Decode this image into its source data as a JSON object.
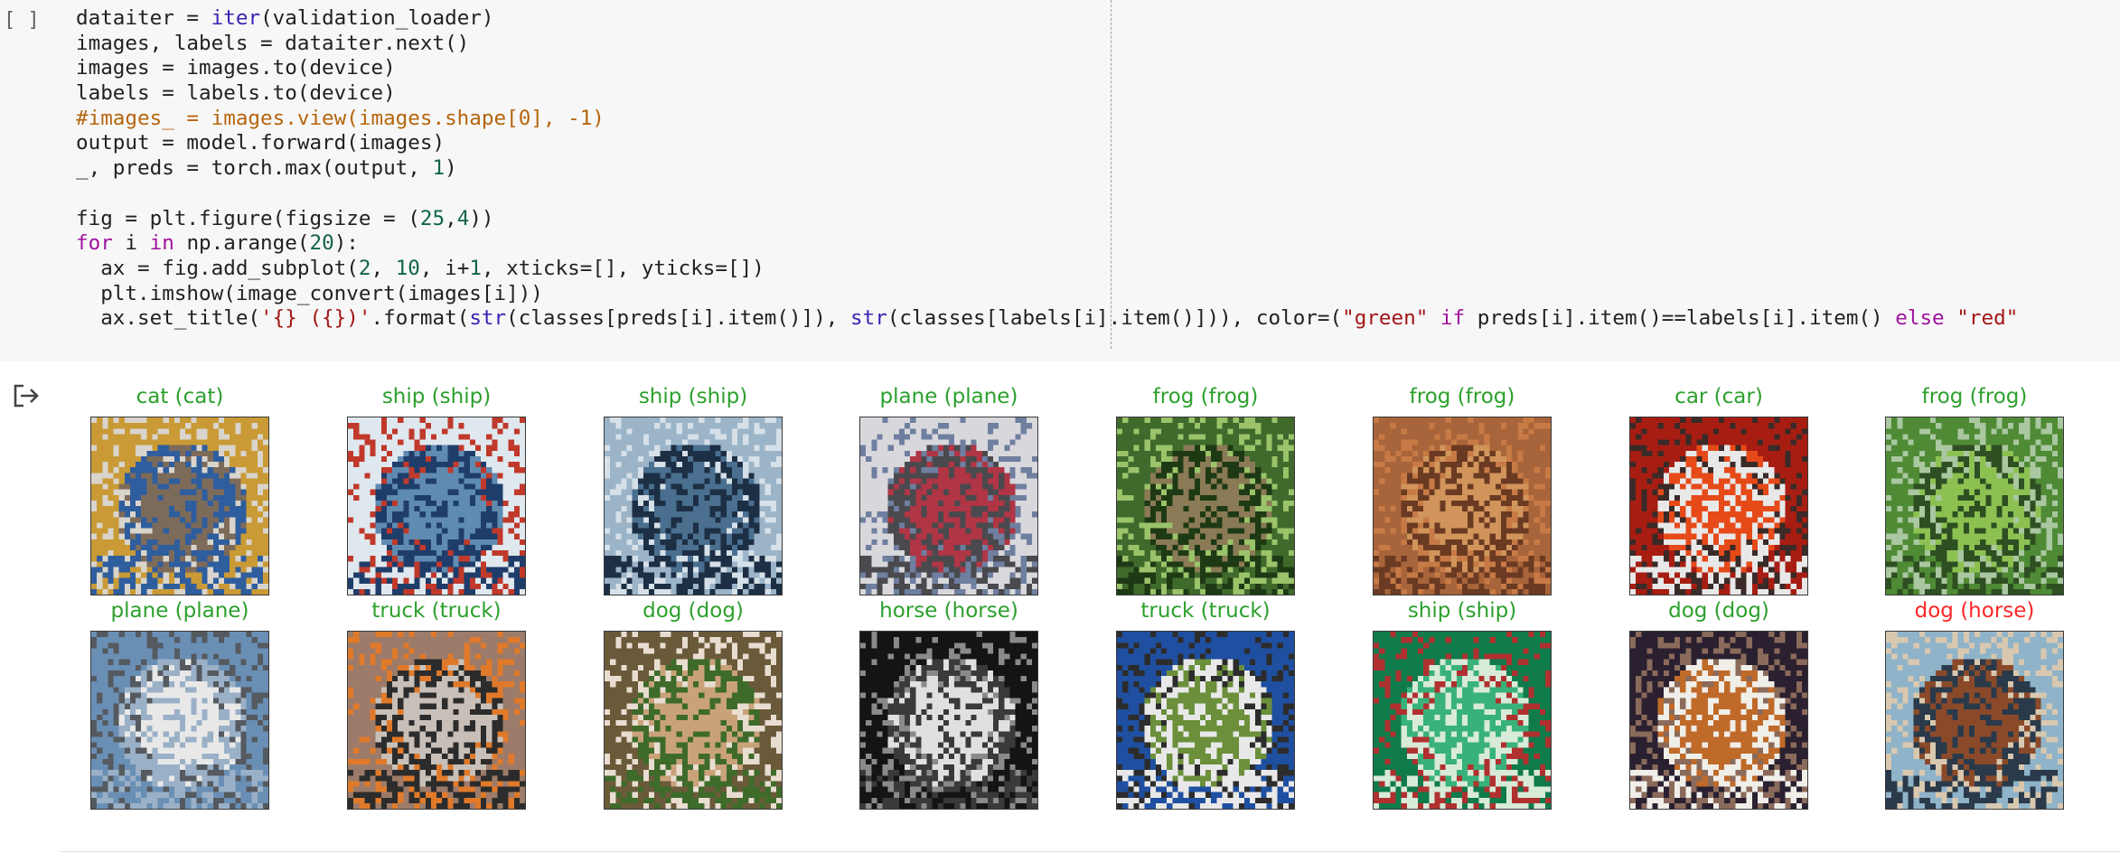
{
  "cell": {
    "run_label": "[ ]",
    "code_lines": [
      [
        {
          "t": "dataiter = "
        },
        {
          "t": "iter",
          "c": "builtin"
        },
        {
          "t": "(validation_loader)"
        }
      ],
      [
        {
          "t": "images, labels = dataiter.next()"
        }
      ],
      [
        {
          "t": "images = images.to(device)"
        }
      ],
      [
        {
          "t": "labels = labels.to(device)"
        }
      ],
      [
        {
          "t": "#images_ = images.view(images.shape[0], -1)",
          "c": "comment"
        }
      ],
      [
        {
          "t": "output = model.forward(images)"
        }
      ],
      [
        {
          "t": "_, preds = torch.max(output, "
        },
        {
          "t": "1",
          "c": "num"
        },
        {
          "t": ")"
        }
      ],
      [
        {
          "t": ""
        }
      ],
      [
        {
          "t": "fig = plt.figure(figsize = ("
        },
        {
          "t": "25",
          "c": "num"
        },
        {
          "t": ","
        },
        {
          "t": "4",
          "c": "num"
        },
        {
          "t": "))"
        }
      ],
      [
        {
          "t": "for",
          "c": "kw"
        },
        {
          "t": " i "
        },
        {
          "t": "in",
          "c": "kw"
        },
        {
          "t": " np.arange("
        },
        {
          "t": "20",
          "c": "num"
        },
        {
          "t": "):"
        }
      ],
      [
        {
          "t": "  ax = fig.add_subplot("
        },
        {
          "t": "2",
          "c": "num"
        },
        {
          "t": ", "
        },
        {
          "t": "10",
          "c": "num"
        },
        {
          "t": ", i+"
        },
        {
          "t": "1",
          "c": "num"
        },
        {
          "t": ", xticks=[], yticks=[])"
        }
      ],
      [
        {
          "t": "  plt.imshow(image_convert(images[i]))"
        }
      ],
      [
        {
          "t": "  ax.set_title("
        },
        {
          "t": "'{} ({})'",
          "c": "str"
        },
        {
          "t": ".format("
        },
        {
          "t": "str",
          "c": "builtin"
        },
        {
          "t": "(classes[preds[i].item()]), "
        },
        {
          "t": "str",
          "c": "builtin"
        },
        {
          "t": "(classes[labels[i].item()])), color=("
        },
        {
          "t": "\"green\"",
          "c": "str"
        },
        {
          "t": " "
        },
        {
          "t": "if",
          "c": "kw"
        },
        {
          "t": " preds[i].item()==labels[i].item() "
        },
        {
          "t": "else",
          "c": "kw"
        },
        {
          "t": " "
        },
        {
          "t": "\"red\"",
          "c": "str"
        }
      ]
    ]
  },
  "colors": {
    "correct": "#2ca02c",
    "wrong": "#ff2727",
    "builtin": "#3b22b3",
    "keyword": "#a0139e",
    "number": "#116644",
    "string": "#a31515",
    "comment": "#b5650d"
  },
  "output": {
    "icon": "output-arrow-icon",
    "subplots": [
      {
        "pred": "cat",
        "label": "cat",
        "title": "cat (cat)",
        "correct": true,
        "palette": [
          "#c99a35",
          "#7d6b5a",
          "#2f5e9e",
          "#d9d4cc"
        ]
      },
      {
        "pred": "ship",
        "label": "ship",
        "title": "ship (ship)",
        "correct": true,
        "palette": [
          "#dfe8ee",
          "#5f8bb0",
          "#1f3d6b",
          "#c0392b"
        ]
      },
      {
        "pred": "ship",
        "label": "ship",
        "title": "ship (ship)",
        "correct": true,
        "palette": [
          "#9bb4c8",
          "#4a6f8f",
          "#1c2f44",
          "#d6e0e8"
        ]
      },
      {
        "pred": "plane",
        "label": "plane",
        "title": "plane (plane)",
        "correct": true,
        "palette": [
          "#d8d8dc",
          "#b03545",
          "#4a4a4e",
          "#6f7fa0"
        ]
      },
      {
        "pred": "frog",
        "label": "frog",
        "title": "frog (frog)",
        "correct": true,
        "palette": [
          "#3f6a2c",
          "#8a7a55",
          "#1e3a14",
          "#9ac36a"
        ]
      },
      {
        "pred": "frog",
        "label": "frog",
        "title": "frog (frog)",
        "correct": true,
        "palette": [
          "#a8643a",
          "#d1955b",
          "#6b3a22",
          "#c77a45"
        ]
      },
      {
        "pred": "car",
        "label": "car",
        "title": "car (car)",
        "correct": true,
        "palette": [
          "#a81d12",
          "#e64a19",
          "#e8e8e8",
          "#3a2a28"
        ]
      },
      {
        "pred": "frog",
        "label": "frog",
        "title": "frog (frog)",
        "correct": true,
        "palette": [
          "#4f8a35",
          "#8cc152",
          "#2e4f22",
          "#a9c7a0"
        ]
      },
      {
        "pred": "plane",
        "label": "plane",
        "title": "plane (plane)",
        "correct": true,
        "palette": [
          "#6a8fb5",
          "#e8e8e8",
          "#9ab0c7",
          "#555a60"
        ]
      },
      {
        "pred": "truck",
        "label": "truck",
        "title": "truck (truck)",
        "correct": true,
        "palette": [
          "#9c7b6a",
          "#c8c0b8",
          "#2c2c2c",
          "#e07a2a"
        ]
      },
      {
        "pred": "dog",
        "label": "dog",
        "title": "dog (dog)",
        "correct": true,
        "palette": [
          "#6b5a3a",
          "#c9a27a",
          "#3e6b2a",
          "#e8ddd0"
        ]
      },
      {
        "pred": "horse",
        "label": "horse",
        "title": "horse (horse)",
        "correct": true,
        "palette": [
          "#141414",
          "#e0e0e0",
          "#3a3a3a",
          "#8a8a8a"
        ]
      },
      {
        "pred": "truck",
        "label": "truck",
        "title": "truck (truck)",
        "correct": true,
        "palette": [
          "#1f4fa0",
          "#6b8f3a",
          "#e8e8e8",
          "#2c2c2c"
        ]
      },
      {
        "pred": "ship",
        "label": "ship",
        "title": "ship (ship)",
        "correct": true,
        "palette": [
          "#0f7a4a",
          "#38b27a",
          "#d8ead8",
          "#b03030"
        ]
      },
      {
        "pred": "dog",
        "label": "dog",
        "title": "dog (dog)",
        "correct": true,
        "palette": [
          "#2a2030",
          "#c06a2a",
          "#f0eee8",
          "#8a6a5a"
        ]
      },
      {
        "pred": "dog",
        "label": "horse",
        "title": "dog (horse)",
        "correct": false,
        "palette": [
          "#8fb3c8",
          "#8a4a2a",
          "#2a3a4a",
          "#d9c8b0"
        ]
      }
    ]
  }
}
